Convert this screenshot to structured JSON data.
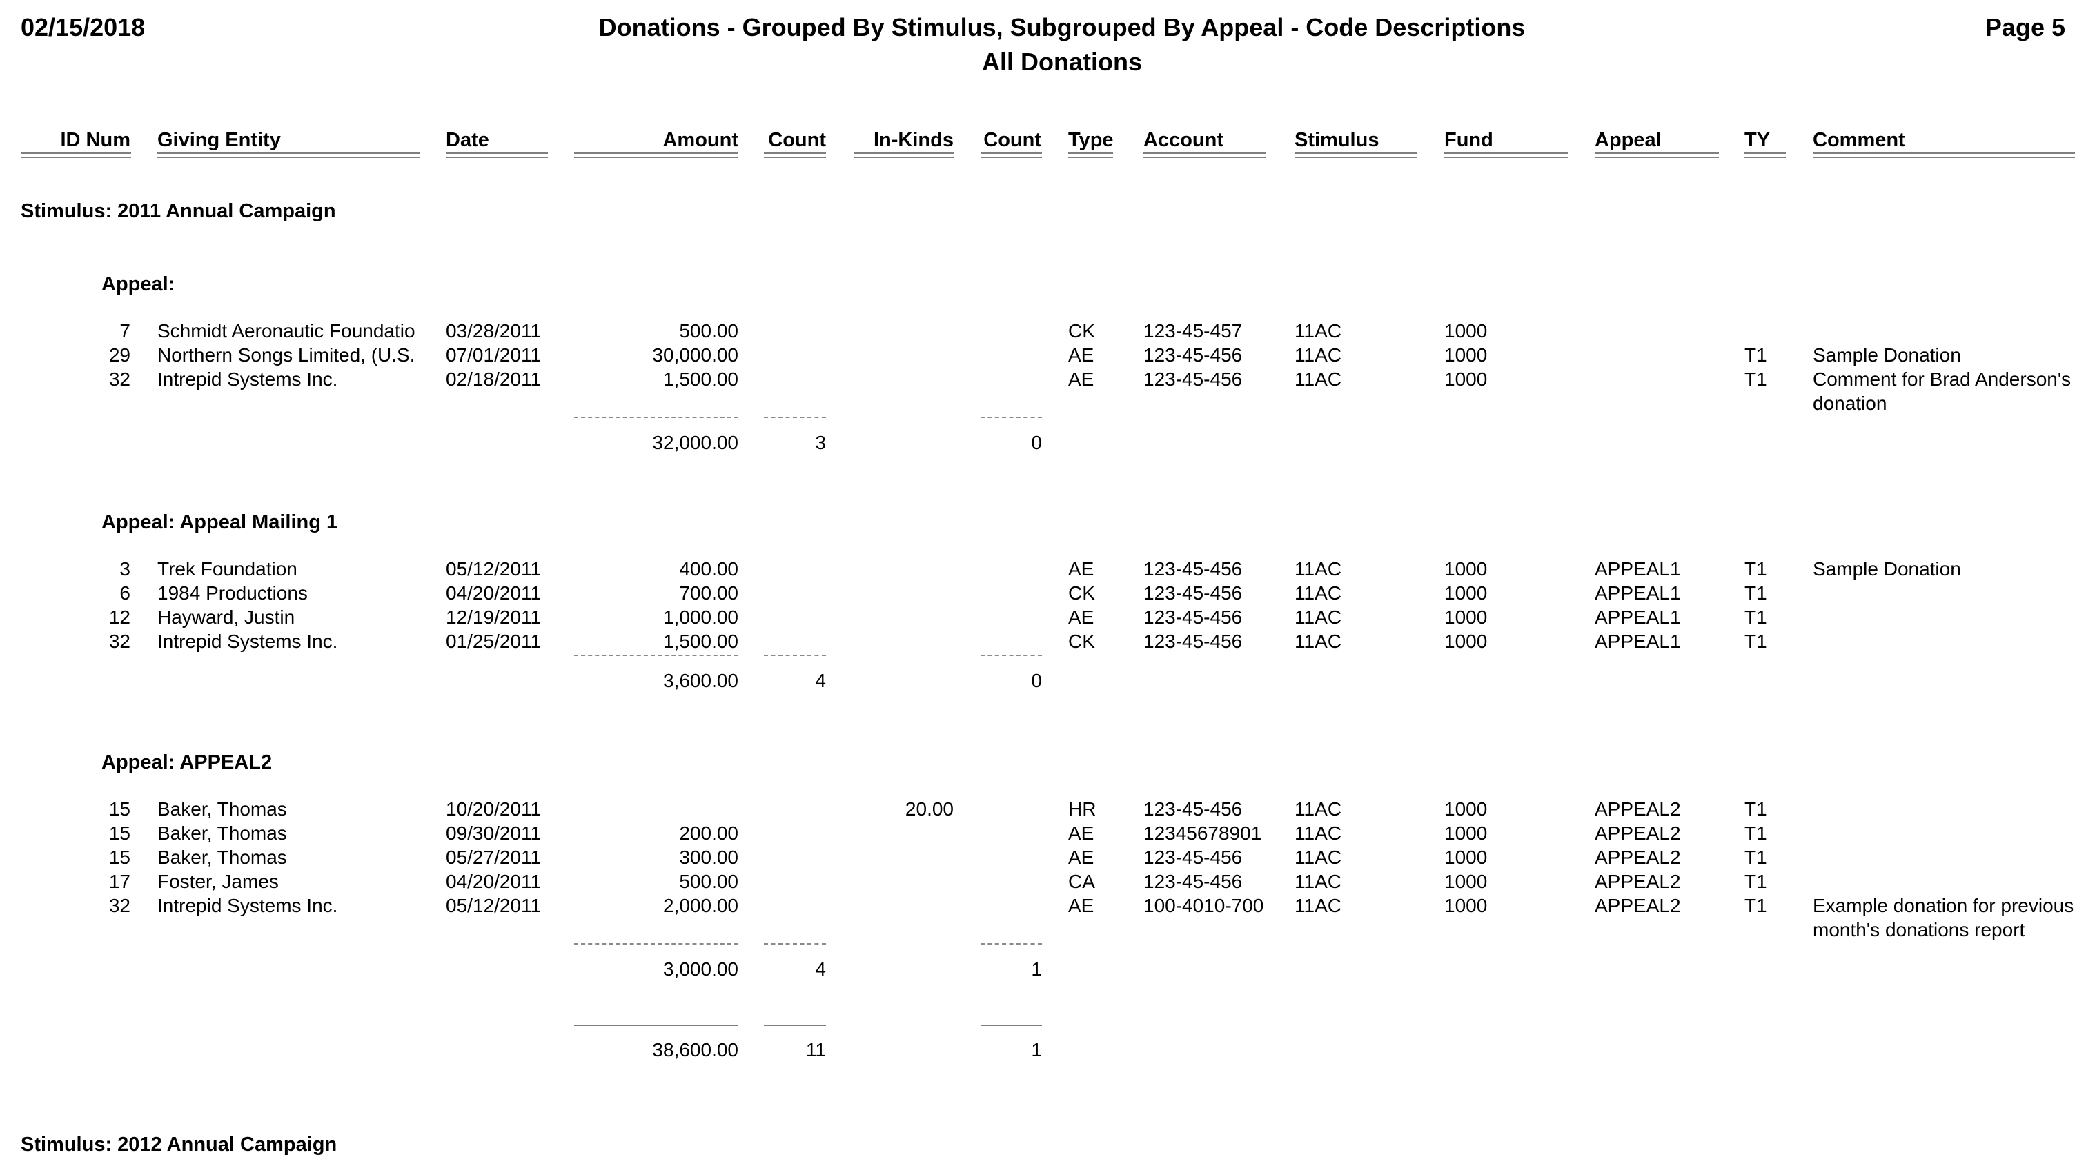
{
  "report": {
    "date": "02/15/2018",
    "title": "Donations - Grouped By Stimulus, Subgrouped By Appeal - Code Descriptions",
    "subtitle": "All Donations",
    "page": "Page 5"
  },
  "columns": {
    "id_num": "ID Num",
    "giving_entity": "Giving Entity",
    "date": "Date",
    "amount": "Amount",
    "count": "Count",
    "in_kinds": "In-Kinds",
    "ik_count": "Count",
    "type": "Type",
    "account": "Account",
    "stimulus": "Stimulus",
    "fund": "Fund",
    "appeal": "Appeal",
    "ty": "TY",
    "comment": "Comment"
  },
  "stimuli": [
    {
      "label": "Stimulus: 2011 Annual Campaign",
      "appeals": [
        {
          "label": "Appeal:",
          "rows": [
            {
              "id": "7",
              "entity": "Schmidt Aeronautic Foundatio",
              "date": "03/28/2011",
              "amount": "500.00",
              "in_kinds": "",
              "type": "CK",
              "account": "123-45-457",
              "stimulus": "11AC",
              "fund": "1000",
              "appeal": "",
              "ty": "",
              "comment": ""
            },
            {
              "id": "29",
              "entity": "Northern Songs Limited, (U.S.",
              "date": "07/01/2011",
              "amount": "30,000.00",
              "in_kinds": "",
              "type": "AE",
              "account": "123-45-456",
              "stimulus": "11AC",
              "fund": "1000",
              "appeal": "",
              "ty": "T1",
              "comment": "Sample Donation"
            },
            {
              "id": "32",
              "entity": "Intrepid Systems Inc.",
              "date": "02/18/2011",
              "amount": "1,500.00",
              "in_kinds": "",
              "type": "AE",
              "account": "123-45-456",
              "stimulus": "11AC",
              "fund": "1000",
              "appeal": "",
              "ty": "T1",
              "comment": "Comment for Brad Anderson's",
              "comment2": "donation"
            }
          ],
          "subtotal": {
            "amount": "32,000.00",
            "count": "3",
            "ik_count": "0"
          }
        },
        {
          "label": "Appeal: Appeal Mailing 1",
          "rows": [
            {
              "id": "3",
              "entity": "Trek Foundation",
              "date": "05/12/2011",
              "amount": "400.00",
              "in_kinds": "",
              "type": "AE",
              "account": "123-45-456",
              "stimulus": "11AC",
              "fund": "1000",
              "appeal": "APPEAL1",
              "ty": "T1",
              "comment": "Sample Donation"
            },
            {
              "id": "6",
              "entity": "1984 Productions",
              "date": "04/20/2011",
              "amount": "700.00",
              "in_kinds": "",
              "type": "CK",
              "account": "123-45-456",
              "stimulus": "11AC",
              "fund": "1000",
              "appeal": "APPEAL1",
              "ty": "T1",
              "comment": ""
            },
            {
              "id": "12",
              "entity": "Hayward, Justin",
              "date": "12/19/2011",
              "amount": "1,000.00",
              "in_kinds": "",
              "type": "AE",
              "account": "123-45-456",
              "stimulus": "11AC",
              "fund": "1000",
              "appeal": "APPEAL1",
              "ty": "T1",
              "comment": ""
            },
            {
              "id": "32",
              "entity": "Intrepid Systems Inc.",
              "date": "01/25/2011",
              "amount": "1,500.00",
              "in_kinds": "",
              "type": "CK",
              "account": "123-45-456",
              "stimulus": "11AC",
              "fund": "1000",
              "appeal": "APPEAL1",
              "ty": "T1",
              "comment": ""
            }
          ],
          "subtotal": {
            "amount": "3,600.00",
            "count": "4",
            "ik_count": "0"
          }
        },
        {
          "label": "Appeal: APPEAL2",
          "rows": [
            {
              "id": "15",
              "entity": "Baker, Thomas",
              "date": "10/20/2011",
              "amount": "",
              "in_kinds": "20.00",
              "type": "HR",
              "account": "123-45-456",
              "stimulus": "11AC",
              "fund": "1000",
              "appeal": "APPEAL2",
              "ty": "T1",
              "comment": ""
            },
            {
              "id": "15",
              "entity": "Baker, Thomas",
              "date": "09/30/2011",
              "amount": "200.00",
              "in_kinds": "",
              "type": "AE",
              "account": "12345678901",
              "stimulus": "11AC",
              "fund": "1000",
              "appeal": "APPEAL2",
              "ty": "T1",
              "comment": ""
            },
            {
              "id": "15",
              "entity": "Baker, Thomas",
              "date": "05/27/2011",
              "amount": "300.00",
              "in_kinds": "",
              "type": "AE",
              "account": "123-45-456",
              "stimulus": "11AC",
              "fund": "1000",
              "appeal": "APPEAL2",
              "ty": "T1",
              "comment": ""
            },
            {
              "id": "17",
              "entity": "Foster, James",
              "date": "04/20/2011",
              "amount": "500.00",
              "in_kinds": "",
              "type": "CA",
              "account": "123-45-456",
              "stimulus": "11AC",
              "fund": "1000",
              "appeal": "APPEAL2",
              "ty": "T1",
              "comment": ""
            },
            {
              "id": "32",
              "entity": "Intrepid Systems Inc.",
              "date": "05/12/2011",
              "amount": "2,000.00",
              "in_kinds": "",
              "type": "AE",
              "account": "100-4010-700",
              "stimulus": "11AC",
              "fund": "1000",
              "appeal": "APPEAL2",
              "ty": "T1",
              "comment": "Example donation for previous",
              "comment2": "month's donations report"
            }
          ],
          "subtotal": {
            "amount": "3,000.00",
            "count": "4",
            "ik_count": "1"
          }
        }
      ],
      "total": {
        "amount": "38,600.00",
        "count": "11",
        "ik_count": "1"
      }
    },
    {
      "label": "Stimulus: 2012 Annual Campaign",
      "appeals": []
    }
  ]
}
